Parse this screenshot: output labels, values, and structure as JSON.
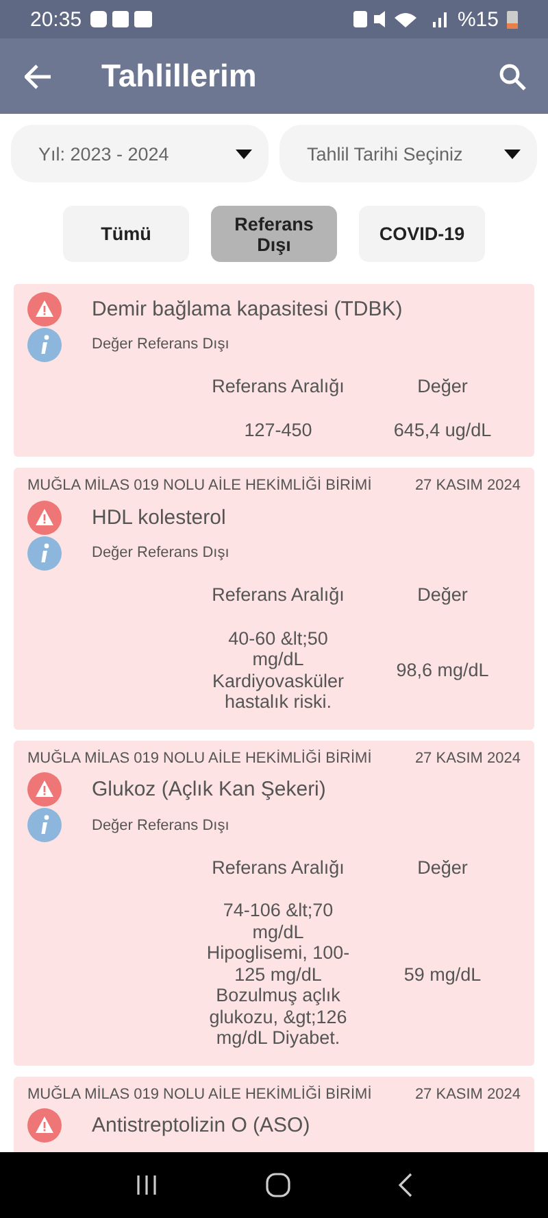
{
  "status_bar": {
    "time": "20:35",
    "battery": "%15"
  },
  "app_bar": {
    "title": "Tahlillerim"
  },
  "filters": [
    {
      "label": "Yıl: 2023 - 2024"
    },
    {
      "label": "Tahlil Tarihi Seçiniz"
    }
  ],
  "tabs": [
    {
      "label": "Tümü",
      "selected": false
    },
    {
      "label": "Referans Dışı",
      "selected": true
    },
    {
      "label": "COVID-19",
      "selected": false
    }
  ],
  "results": [
    {
      "test": "Demir bağlama kapasitesi (TDBK)",
      "status": "Değer Referans Dışı",
      "range_label": "Referans Aralığı",
      "value_label": "Değer",
      "range": "127-450",
      "value": "645,4 ug/dL"
    },
    {
      "clinic": "MUĞLA MİLAS 019 NOLU AİLE HEKİMLİĞİ BİRİMİ",
      "date": "27 KASIM 2024",
      "test": "HDL kolesterol",
      "status": "Değer Referans Dışı",
      "range_label": "Referans Aralığı",
      "value_label": "Değer",
      "range": "40-60 &lt;50 mg/dL Kardiyovasküler hastalık riski.",
      "value": "98,6 mg/dL"
    },
    {
      "clinic": "MUĞLA MİLAS 019 NOLU AİLE HEKİMLİĞİ BİRİMİ",
      "date": "27 KASIM 2024",
      "test": "Glukoz (Açlık Kan Şekeri)",
      "status": "Değer Referans Dışı",
      "range_label": "Referans Aralığı",
      "value_label": "Değer",
      "range": "74-106 &lt;70 mg/dL Hipoglisemi, 100-125 mg/dL Bozulmuş açlık glukozu, &gt;126 mg/dL Diyabet.",
      "value": "59 mg/dL"
    },
    {
      "clinic": "MUĞLA MİLAS 019 NOLU AİLE HEKİMLİĞİ BİRİMİ",
      "date": "27 KASIM 2024",
      "test": "Antistreptolizin O (ASO)"
    }
  ]
}
